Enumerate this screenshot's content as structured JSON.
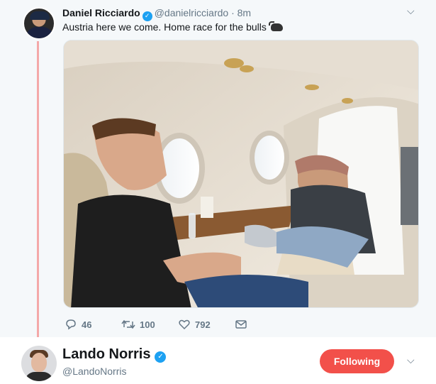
{
  "tweet": {
    "author_name": "Daniel Ricciardo",
    "author_handle": "@danielricciardo",
    "separator": "·",
    "time": "8m",
    "text": "Austria here we come. Home race for the bulls",
    "emoji": "water-buffalo-emoji",
    "actions": {
      "reply_count": "46",
      "retweet_count": "100",
      "like_count": "792"
    }
  },
  "profile_card": {
    "name": "Lando Norris",
    "handle": "@LandoNorris",
    "follow_label": "Following"
  },
  "colors": {
    "thread_line": "#f4a8a8",
    "verified_badge": "#1da1f2",
    "following_button": "#f2504a",
    "secondary_text": "#657786"
  },
  "icons": [
    "verified-badge-icon",
    "chevron-down-icon",
    "reply-icon",
    "retweet-icon",
    "like-icon",
    "direct-message-icon"
  ]
}
